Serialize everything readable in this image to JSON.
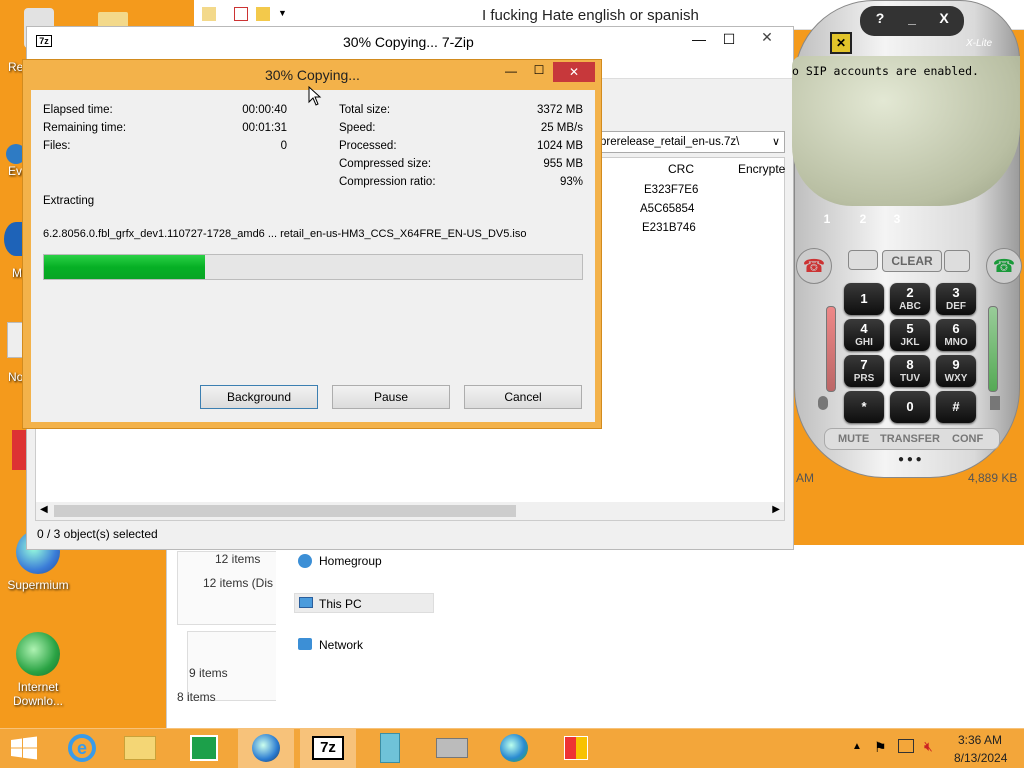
{
  "desktop": {
    "icons": [
      {
        "label": "Re",
        "color": "#d9d9d9"
      },
      {
        "label": "Ev",
        "color": "#2e7bc4"
      },
      {
        "label": "M",
        "color": "#1e63b8"
      },
      {
        "label": "No",
        "color": "#e8e8e8"
      },
      {
        "label": "",
        "color": "#d33"
      },
      {
        "label": "Supermium",
        "color": "#3b7dd8"
      },
      {
        "label": "Internet Downlo...",
        "color": "#2aa344"
      }
    ]
  },
  "explorer_back": {
    "title": "I fucking Hate english or spanish",
    "nav": {
      "homegroup": "Homegroup",
      "this_pc": "This PC",
      "network": "Network"
    },
    "left_counts": [
      "12 items",
      "12 items (Dis",
      "9 items",
      "8 items"
    ]
  },
  "archive_window": {
    "title": "30% Copying... 7-Zip",
    "path": "prerelease_retail_en-us.7z\\",
    "columns": {
      "crc": "CRC",
      "encrypted": "Encrypte"
    },
    "rows": [
      {
        "crc": "E323F7E6"
      },
      {
        "crc": "A5C65854"
      },
      {
        "crc": "E231B746"
      }
    ],
    "status": "0 / 3 object(s) selected",
    "right_fragments": {
      "time": "AM",
      "size": "4,889 KB"
    }
  },
  "progress_dialog": {
    "title": "30% Copying...",
    "left": [
      {
        "label": "Elapsed time:",
        "value": "00:00:40"
      },
      {
        "label": "Remaining time:",
        "value": "00:01:31"
      },
      {
        "label": "Files:",
        "value": "0"
      }
    ],
    "right": [
      {
        "label": "Total size:",
        "value": "3372 MB"
      },
      {
        "label": "Speed:",
        "value": "25 MB/s"
      },
      {
        "label": "Processed:",
        "value": "1024 MB"
      },
      {
        "label": "Compressed size:",
        "value": "955 MB"
      },
      {
        "label": "Compression ratio:",
        "value": "93%"
      }
    ],
    "operation": "Extracting",
    "file": "6.2.8056.0.fbl_grfx_dev1.110727-1728_amd6 ... retail_en-us-HM3_CCS_X64FRE_EN-US_DV5.iso",
    "progress": 0.3,
    "buttons": {
      "background": "Background",
      "pause": "Pause",
      "cancel": "Cancel"
    }
  },
  "xlite": {
    "brand": "X-Lite",
    "top_buttons": [
      "?",
      "_",
      "X"
    ],
    "display": "o SIP accounts are enabled.",
    "lines": [
      "1",
      "2",
      "3"
    ],
    "clear": "CLEAR",
    "keys": [
      {
        "d": "1",
        "l": ""
      },
      {
        "d": "2",
        "l": "ABC"
      },
      {
        "d": "3",
        "l": "DEF"
      },
      {
        "d": "4",
        "l": "GHI"
      },
      {
        "d": "5",
        "l": "JKL"
      },
      {
        "d": "6",
        "l": "MNO"
      },
      {
        "d": "7",
        "l": "PRS"
      },
      {
        "d": "8",
        "l": "TUV"
      },
      {
        "d": "9",
        "l": "WXY"
      },
      {
        "d": "*",
        "l": ""
      },
      {
        "d": "0",
        "l": ""
      },
      {
        "d": "#",
        "l": ""
      }
    ],
    "bottom": {
      "mute": "MUTE",
      "transfer": "TRANSFER",
      "conf": "CONF"
    }
  },
  "taskbar": {
    "time": "3:36 AM",
    "date": "8/13/2024",
    "apps": [
      "start-icon",
      "internet-explorer-icon",
      "file-explorer-icon",
      "store-icon",
      "browser-icon",
      "7zip-icon",
      "notepad-icon",
      "scanner-icon",
      "idm-icon",
      "office-icon"
    ],
    "colors": {
      "bar": "#f3a63a",
      "accent": "#f49a1c"
    }
  }
}
